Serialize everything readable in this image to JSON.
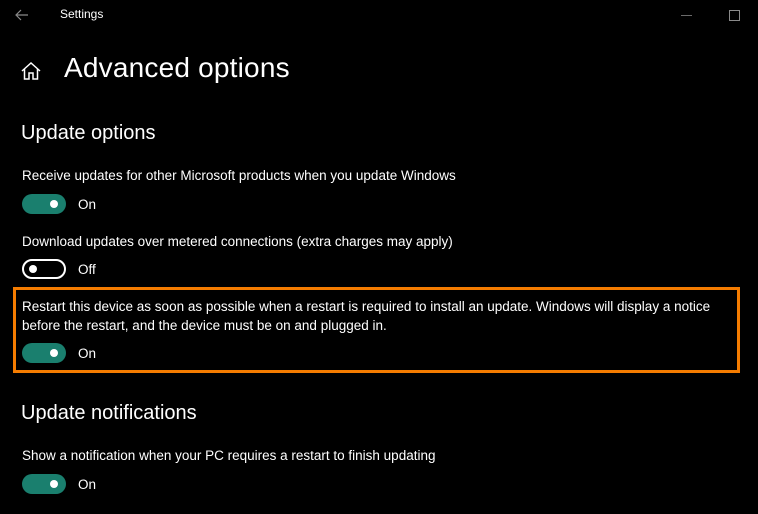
{
  "window": {
    "app_title": "Settings"
  },
  "header": {
    "page_title": "Advanced options"
  },
  "sections": {
    "update_options": {
      "title": "Update options",
      "options": [
        {
          "text": "Receive updates for other Microsoft products when you update Windows",
          "state": "On",
          "enabled": true
        },
        {
          "text": "Download updates over metered connections (extra charges may apply)",
          "state": "Off",
          "enabled": false
        },
        {
          "text_line1": "Restart this device as soon as possible when a restart is required to install an update. Windows will display a notice",
          "text_line2": "before the restart, and the device must be on and plugged in.",
          "state": "On",
          "enabled": true,
          "highlighted": true
        }
      ]
    },
    "update_notifications": {
      "title": "Update notifications",
      "options": [
        {
          "text": "Show a notification when your PC requires a restart to finish updating",
          "state": "On",
          "enabled": true
        }
      ]
    }
  },
  "colors": {
    "background": "#000000",
    "toggle_on": "#1a7f6e",
    "highlight": "#f57c00"
  },
  "icons": {
    "back": "back-arrow-icon",
    "home": "home-icon",
    "minimize": "minimize-icon",
    "maximize": "maximize-icon"
  }
}
